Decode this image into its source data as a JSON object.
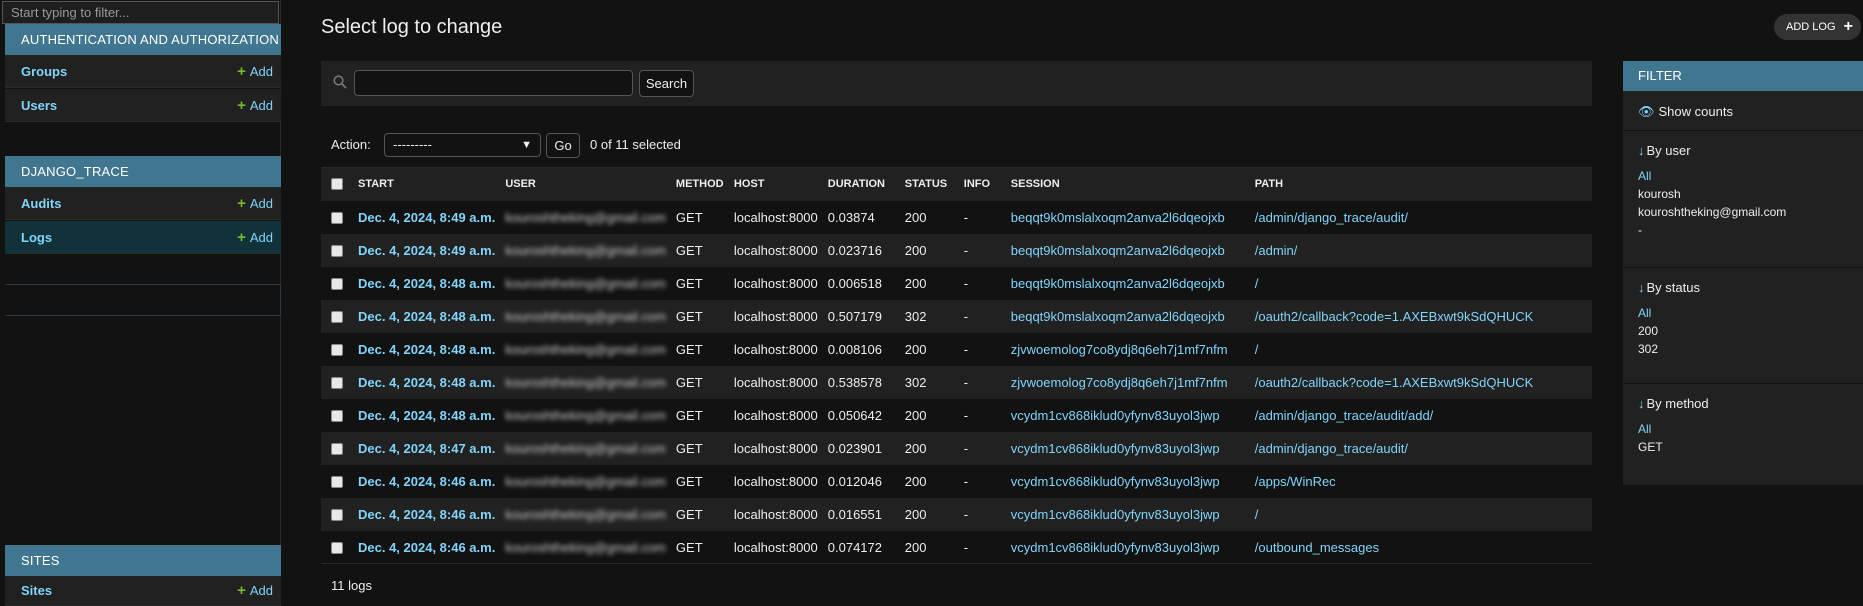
{
  "nav": {
    "filter_placeholder": "Start typing to filter...",
    "apps": [
      {
        "caption": "AUTHENTICATION AND AUTHORIZATION",
        "models": [
          {
            "name": "Groups",
            "add": "Add"
          },
          {
            "name": "Users",
            "add": "Add"
          }
        ]
      },
      {
        "caption": "DJANGO_TRACE",
        "models": [
          {
            "name": "Audits",
            "add": "Add"
          },
          {
            "name": "Logs",
            "add": "Add",
            "current": true
          }
        ]
      },
      {
        "caption": "SITES",
        "models": [
          {
            "name": "Sites",
            "add": "Add"
          }
        ]
      }
    ]
  },
  "header": {
    "title": "Select log to change",
    "add_button": "ADD LOG"
  },
  "search": {
    "button": "Search",
    "value": ""
  },
  "actions": {
    "label": "Action:",
    "selected": "---------",
    "go": "Go",
    "counter": "0 of 11 selected"
  },
  "table": {
    "columns": [
      "START",
      "USER",
      "METHOD",
      "HOST",
      "DURATION",
      "STATUS",
      "INFO",
      "SESSION",
      "PATH"
    ],
    "rows": [
      {
        "start": "Dec. 4, 2024, 8:49 a.m.",
        "user": "kouroshtheking@gmail.com",
        "method": "GET",
        "host": "localhost:8000",
        "duration": "0.03874",
        "status": "200",
        "info": "-",
        "session": "beqqt9k0mslalxoqm2anva2l6dqeojxb",
        "path": "/admin/django_trace/audit/"
      },
      {
        "start": "Dec. 4, 2024, 8:49 a.m.",
        "user": "kouroshtheking@gmail.com",
        "method": "GET",
        "host": "localhost:8000",
        "duration": "0.023716",
        "status": "200",
        "info": "-",
        "session": "beqqt9k0mslalxoqm2anva2l6dqeojxb",
        "path": "/admin/"
      },
      {
        "start": "Dec. 4, 2024, 8:48 a.m.",
        "user": "kouroshtheking@gmail.com",
        "method": "GET",
        "host": "localhost:8000",
        "duration": "0.006518",
        "status": "200",
        "info": "-",
        "session": "beqqt9k0mslalxoqm2anva2l6dqeojxb",
        "path": "/"
      },
      {
        "start": "Dec. 4, 2024, 8:48 a.m.",
        "user": "kouroshtheking@gmail.com",
        "method": "GET",
        "host": "localhost:8000",
        "duration": "0.507179",
        "status": "302",
        "info": "-",
        "session": "beqqt9k0mslalxoqm2anva2l6dqeojxb",
        "path": "/oauth2/callback?code=1.AXEBxwt9kSdQHUCK"
      },
      {
        "start": "Dec. 4, 2024, 8:48 a.m.",
        "user": "kouroshtheking@gmail.com",
        "method": "GET",
        "host": "localhost:8000",
        "duration": "0.008106",
        "status": "200",
        "info": "-",
        "session": "zjvwoemolog7co8ydj8q6eh7j1mf7nfm",
        "path": "/"
      },
      {
        "start": "Dec. 4, 2024, 8:48 a.m.",
        "user": "kouroshtheking@gmail.com",
        "method": "GET",
        "host": "localhost:8000",
        "duration": "0.538578",
        "status": "302",
        "info": "-",
        "session": "zjvwoemolog7co8ydj8q6eh7j1mf7nfm",
        "path": "/oauth2/callback?code=1.AXEBxwt9kSdQHUCK"
      },
      {
        "start": "Dec. 4, 2024, 8:48 a.m.",
        "user": "kouroshtheking@gmail.com",
        "method": "GET",
        "host": "localhost:8000",
        "duration": "0.050642",
        "status": "200",
        "info": "-",
        "session": "vcydm1cv868iklud0yfynv83uyol3jwp",
        "path": "/admin/django_trace/audit/add/"
      },
      {
        "start": "Dec. 4, 2024, 8:47 a.m.",
        "user": "kouroshtheking@gmail.com",
        "method": "GET",
        "host": "localhost:8000",
        "duration": "0.023901",
        "status": "200",
        "info": "-",
        "session": "vcydm1cv868iklud0yfynv83uyol3jwp",
        "path": "/admin/django_trace/audit/"
      },
      {
        "start": "Dec. 4, 2024, 8:46 a.m.",
        "user": "kouroshtheking@gmail.com",
        "method": "GET",
        "host": "localhost:8000",
        "duration": "0.012046",
        "status": "200",
        "info": "-",
        "session": "vcydm1cv868iklud0yfynv83uyol3jwp",
        "path": "/apps/WinRec"
      },
      {
        "start": "Dec. 4, 2024, 8:46 a.m.",
        "user": "kouroshtheking@gmail.com",
        "method": "GET",
        "host": "localhost:8000",
        "duration": "0.016551",
        "status": "200",
        "info": "-",
        "session": "vcydm1cv868iklud0yfynv83uyol3jwp",
        "path": "/"
      },
      {
        "start": "Dec. 4, 2024, 8:46 a.m.",
        "user": "kouroshtheking@gmail.com",
        "method": "GET",
        "host": "localhost:8000",
        "duration": "0.074172",
        "status": "200",
        "info": "-",
        "session": "vcydm1cv868iklud0yfynv83uyol3jwp",
        "path": "/outbound_messages"
      }
    ]
  },
  "paginator": "11 logs",
  "filter": {
    "title": "FILTER",
    "show_counts": "Show counts",
    "sections": [
      {
        "heading": "By user",
        "options": [
          "All",
          "kourosh",
          "kouroshtheking@gmail.com",
          "-"
        ]
      },
      {
        "heading": "By status",
        "options": [
          "All",
          "200",
          "302"
        ]
      },
      {
        "heading": "By method",
        "options": [
          "All",
          "GET"
        ]
      }
    ]
  },
  "colors": {
    "accent": "#417690",
    "link": "#81d4fa",
    "add_plus": "#70bf2b",
    "background": "#121212",
    "row_alt": "#212121"
  },
  "icons": {
    "search": "search-icon",
    "add": "plus-icon",
    "eye": "eye-icon",
    "sort": "arrow-down-icon"
  }
}
